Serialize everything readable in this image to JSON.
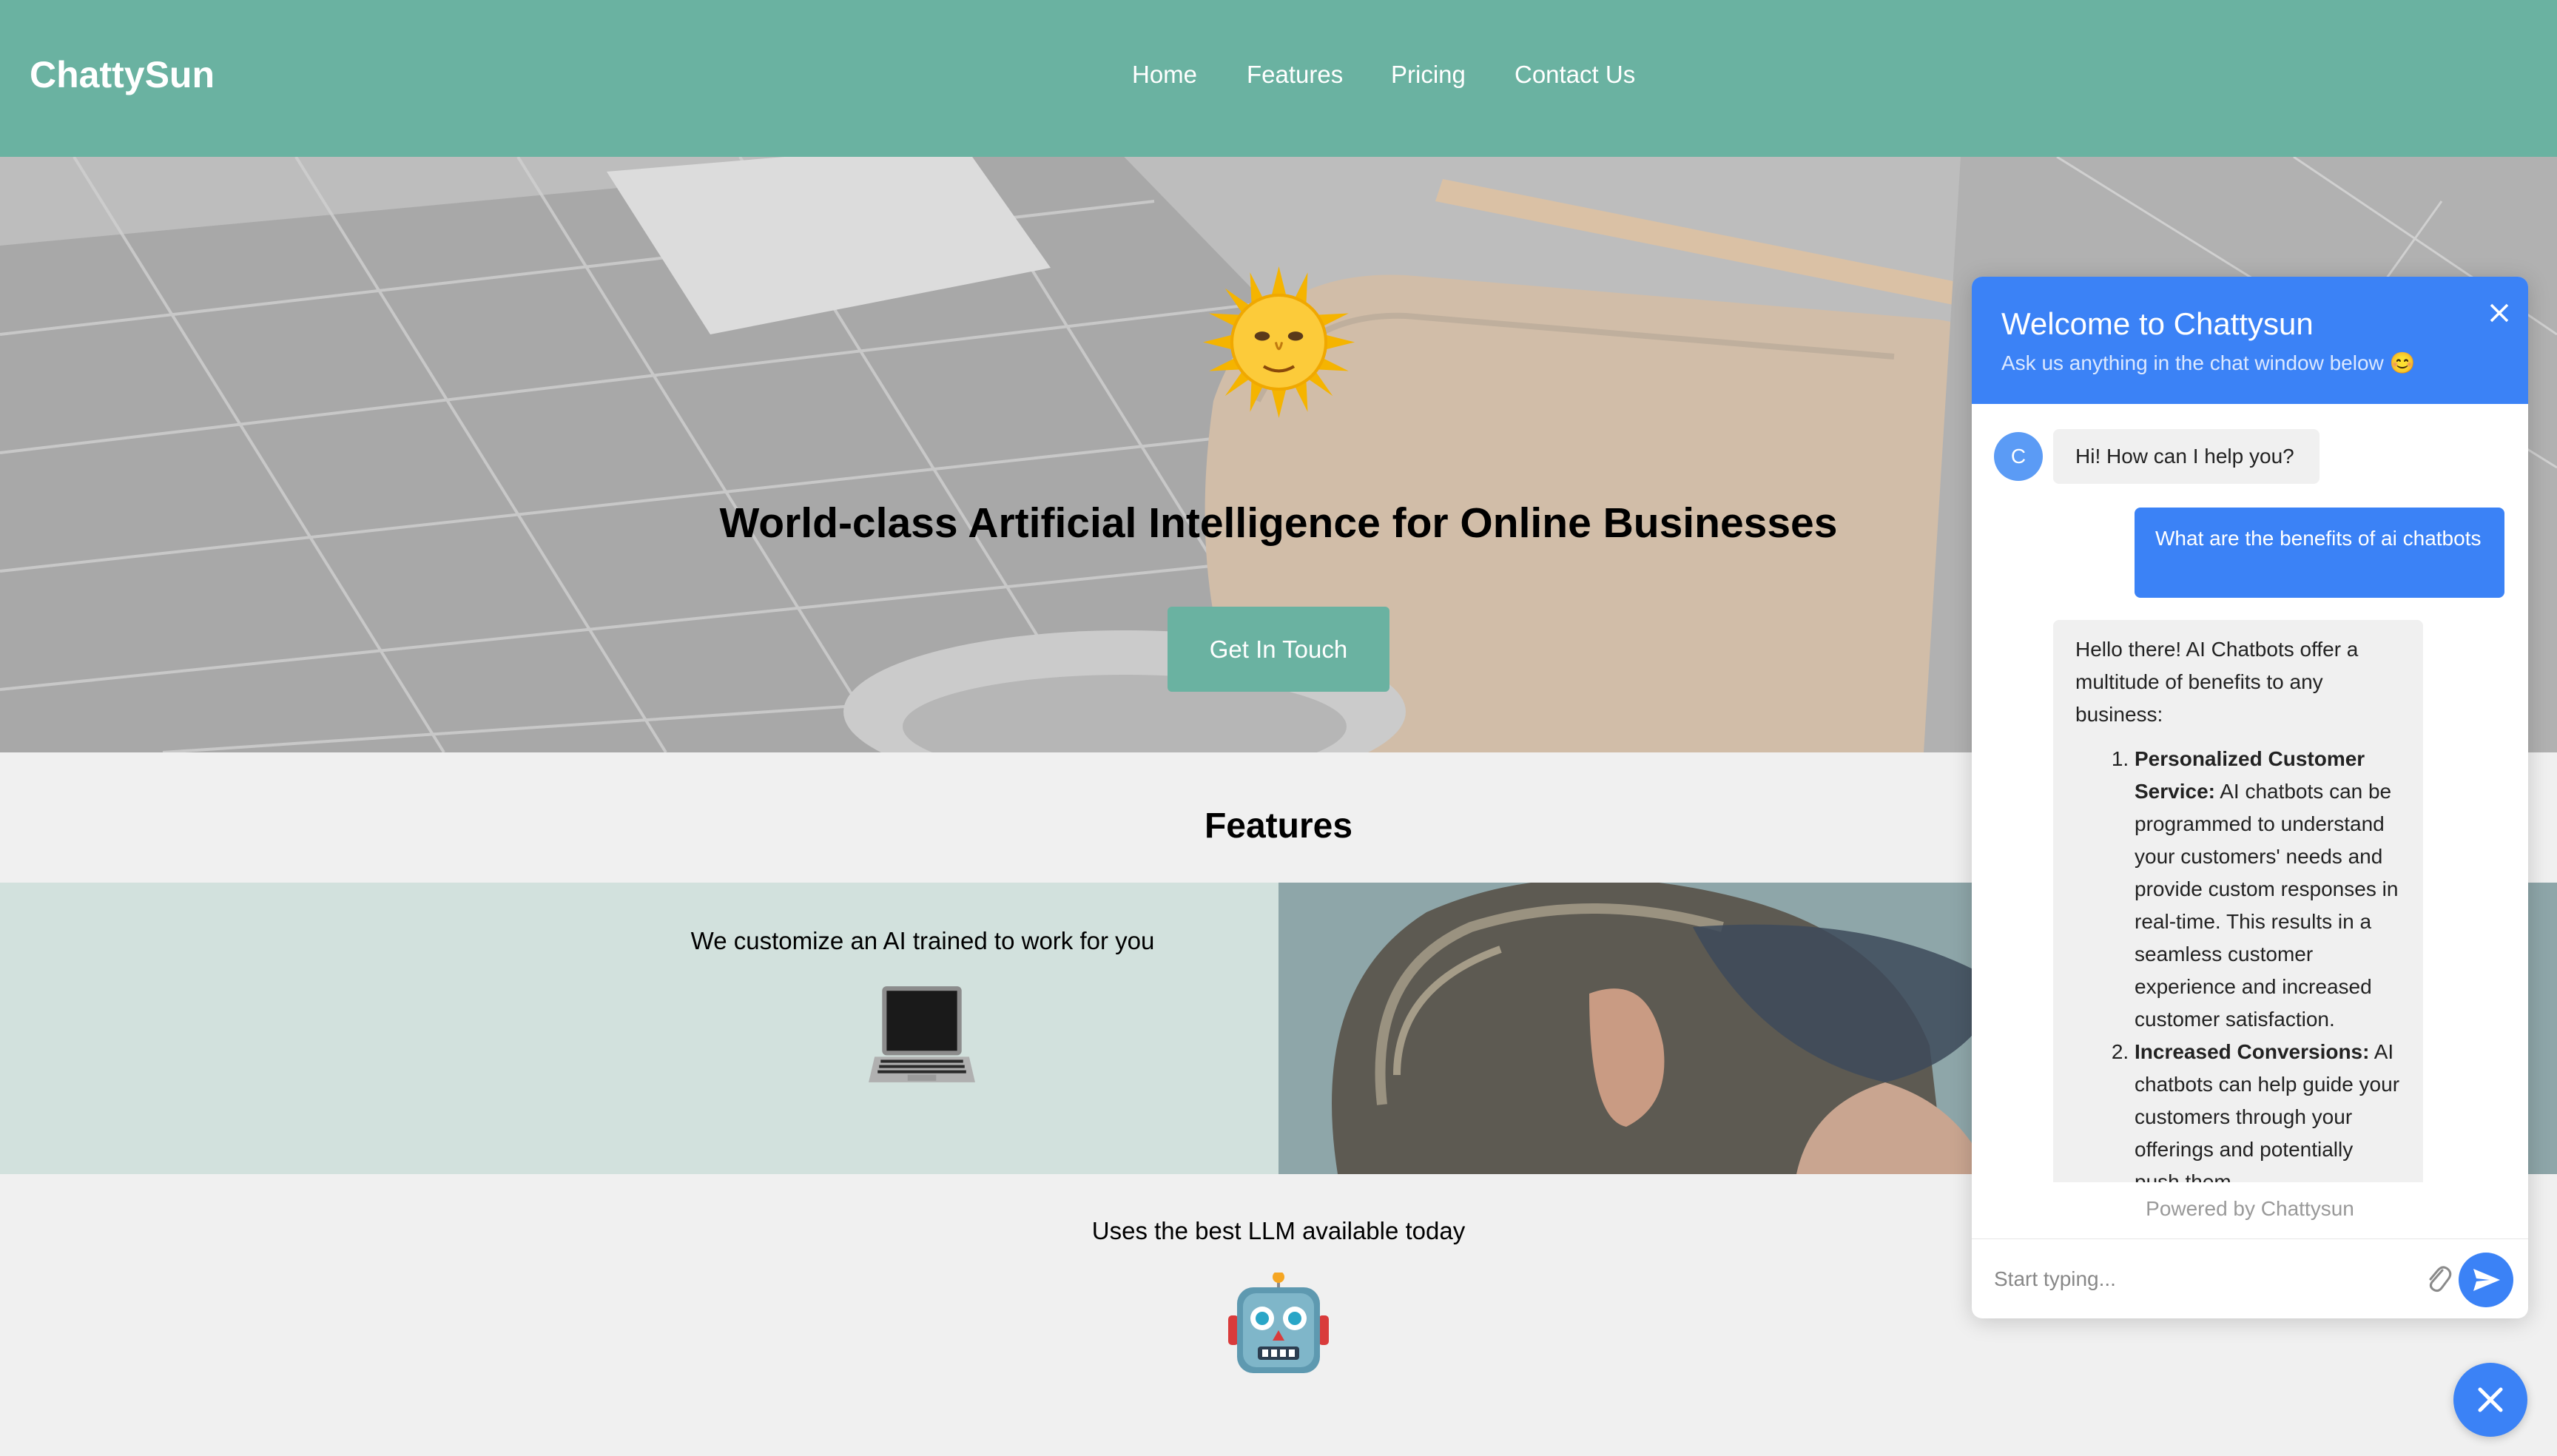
{
  "navbar": {
    "brand": "ChattySun",
    "links": [
      "Home",
      "Features",
      "Pricing",
      "Contact Us"
    ]
  },
  "hero": {
    "title": "World-class Artificial Intelligence for Online Businesses",
    "button_label": "Get In Touch",
    "emoji": "sun-with-face-icon"
  },
  "features": {
    "heading": "Features",
    "items": [
      {
        "text": "We customize an AI trained to work for you",
        "icon": "laptop-icon"
      },
      {
        "text": "Uses the best LLM available today",
        "icon": "robot-icon"
      }
    ]
  },
  "chat": {
    "title": "Welcome to Chattysun",
    "subtitle": "Ask us anything in the chat window below 😊",
    "avatar_letter": "C",
    "greeting": "Hi! How can I help you?",
    "user_message": "What are the benefits of ai chatbots",
    "reply_intro": "Hello there! AI Chatbots offer a multitude of benefits to any business:",
    "reply_points": [
      {
        "title": "Personalized Customer Service:",
        "body": "AI chatbots can be programmed to understand your customers' needs and provide custom responses in real-time. This results in a seamless customer experience and increased customer satisfaction."
      },
      {
        "title": "Increased Conversions:",
        "body": "AI chatbots can help guide your customers through your offerings and potentially push them"
      }
    ],
    "powered_by": "Powered by Chattysun",
    "input_placeholder": "Start typing...",
    "accent_color": "#3b82f6"
  },
  "theme": {
    "primary": "#6ab2a1",
    "feature_bg": "#d2e1dd"
  }
}
